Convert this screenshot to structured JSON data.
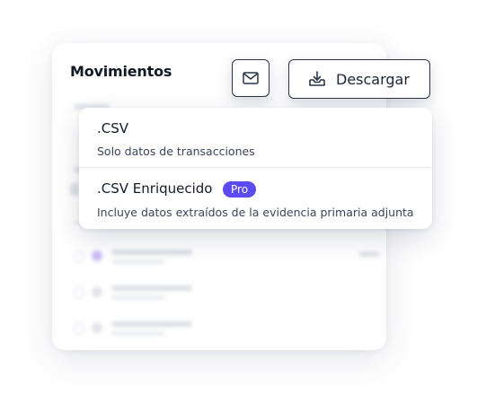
{
  "header": {
    "title": "Movimientos",
    "download_label": "Descargar"
  },
  "icons": {
    "mail": "mail-icon",
    "download": "download-tray-icon"
  },
  "menu": {
    "items": [
      {
        "title": ".CSV",
        "description": "Solo datos de transacciones"
      },
      {
        "title": ".CSV Enriquecido",
        "badge": "Pro",
        "description": "Incluye datos extraídos de la evidencia primaria adjunta"
      }
    ]
  },
  "colors": {
    "accent": "#5b4bf0",
    "border": "#2b3345",
    "text": "#141a28"
  }
}
